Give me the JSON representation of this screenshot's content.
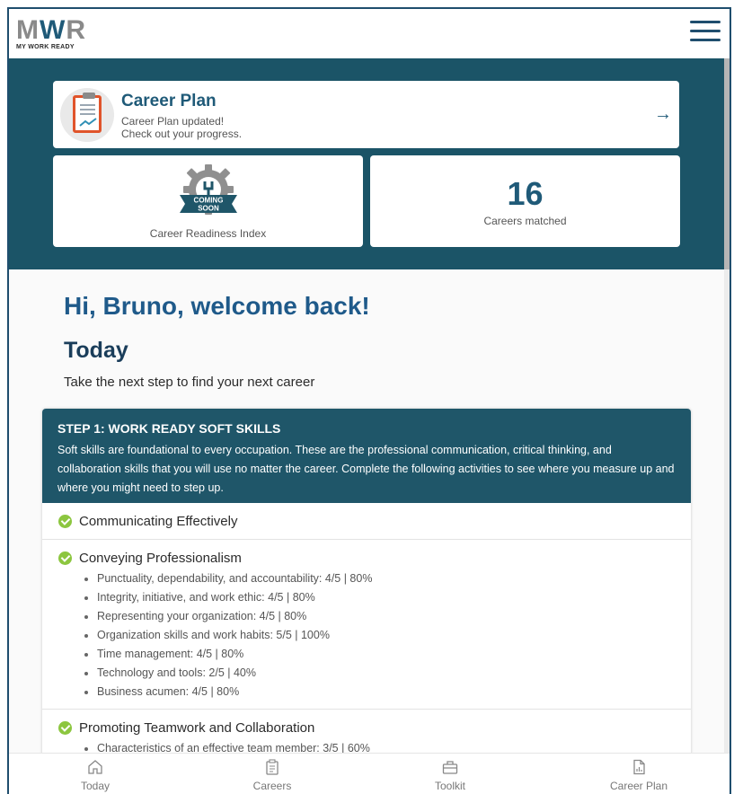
{
  "app": {
    "logo_text": "MWR",
    "logo_tagline": "MY WORK READY"
  },
  "hero": {
    "career_plan": {
      "title": "Career Plan",
      "line1": "Career Plan updated!",
      "line2": "Check out your progress.",
      "arrow": "→"
    },
    "readiness": {
      "badge_line1": "COMING",
      "badge_line2": "SOON",
      "label": "Career Readiness Index"
    },
    "matched": {
      "count": "16",
      "label": "Careers matched"
    }
  },
  "main": {
    "greeting": "Hi, Bruno, welcome back!",
    "today_title": "Today",
    "today_subtitle": "Take the next step to find your next career"
  },
  "step1": {
    "title": "STEP 1: WORK READY SOFT SKILLS",
    "description": "Soft skills are foundational to every occupation. These are the professional communication, critical thinking, and collaboration skills that you will use no matter the career. Complete the following activities to see where you measure up and where you might need to step up.",
    "sections": [
      {
        "title": "Communicating Effectively",
        "items": []
      },
      {
        "title": "Conveying Professionalism",
        "items": [
          "Punctuality, dependability, and accountability: 4/5 | 80%",
          "Integrity, initiative, and work ethic: 4/5 | 80%",
          "Representing your organization: 4/5 | 80%",
          "Organization skills and work habits: 5/5 | 100%",
          "Time management: 4/5 | 80%",
          "Technology and tools: 2/5 | 40%",
          "Business acumen: 4/5 | 80%"
        ]
      },
      {
        "title": "Promoting Teamwork and Collaboration",
        "items": [
          "Characteristics of an effective team member: 3/5 | 60%"
        ]
      }
    ]
  },
  "bottom_nav": [
    {
      "label": "Today",
      "icon": "home-icon"
    },
    {
      "label": "Careers",
      "icon": "clipboard-list-icon"
    },
    {
      "label": "Toolkit",
      "icon": "toolbox-icon"
    },
    {
      "label": "Career Plan",
      "icon": "document-chart-icon"
    }
  ],
  "colors": {
    "hero_bg": "#1b5467",
    "step_header_bg": "#1f5669",
    "accent_blue": "#1f5a78",
    "check_green": "#8cc63f",
    "clipboard_orange": "#e0542b"
  }
}
